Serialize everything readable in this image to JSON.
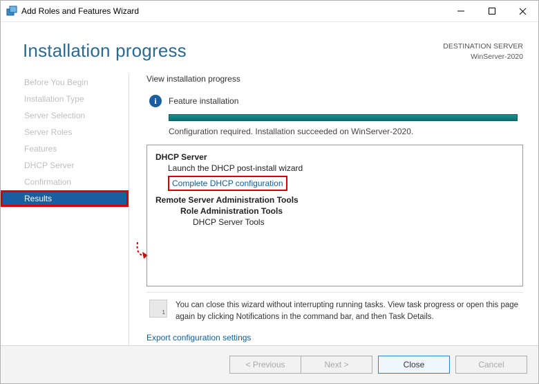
{
  "window": {
    "title": "Add Roles and Features Wizard"
  },
  "header": {
    "page_title": "Installation progress",
    "destination_label": "DESTINATION SERVER",
    "destination_value": "WinServer-2020"
  },
  "sidebar": {
    "items": [
      {
        "label": "Before You Begin",
        "active": false
      },
      {
        "label": "Installation Type",
        "active": false
      },
      {
        "label": "Server Selection",
        "active": false
      },
      {
        "label": "Server Roles",
        "active": false
      },
      {
        "label": "Features",
        "active": false
      },
      {
        "label": "DHCP Server",
        "active": false
      },
      {
        "label": "Confirmation",
        "active": false
      },
      {
        "label": "Results",
        "active": true
      }
    ]
  },
  "main": {
    "heading": "View installation progress",
    "status_label": "Feature installation",
    "status_text": "Configuration required. Installation succeeded on WinServer-2020.",
    "results": {
      "dhcp_title": "DHCP Server",
      "dhcp_sub": "Launch the DHCP post-install wizard",
      "dhcp_link": "Complete DHCP configuration",
      "rsat_title": "Remote Server Administration Tools",
      "rsat_sub": "Role Administration Tools",
      "rsat_sub2": "DHCP Server Tools"
    },
    "note": "You can close this wizard without interrupting running tasks. View task progress or open this page again by clicking Notifications in the command bar, and then Task Details.",
    "export_link": "Export configuration settings"
  },
  "footer": {
    "previous": "< Previous",
    "next": "Next >",
    "close": "Close",
    "cancel": "Cancel"
  }
}
